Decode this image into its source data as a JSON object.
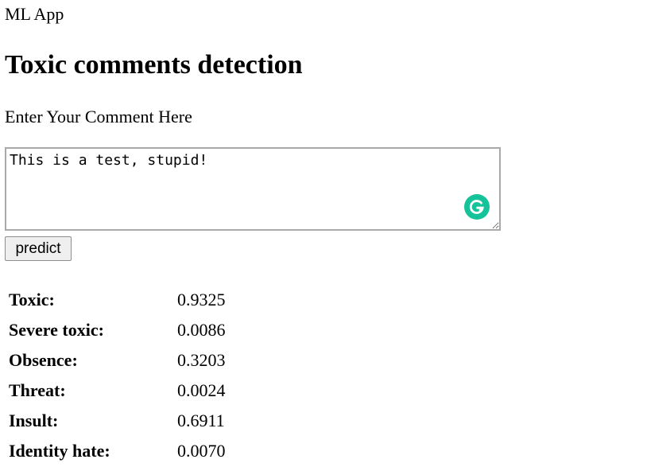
{
  "app_title": "ML App",
  "heading": "Toxic comments detection",
  "prompt_label": "Enter Your Comment Here",
  "comment": {
    "value": "This is a test, stupid!"
  },
  "grammar_badge": {
    "icon": "grammarly-icon",
    "color": "#15c39a"
  },
  "predict_label": "predict",
  "results": [
    {
      "label": "Toxic:",
      "value": "0.9325"
    },
    {
      "label": "Severe toxic:",
      "value": "0.0086"
    },
    {
      "label": "Obsence:",
      "value": "0.3203"
    },
    {
      "label": "Threat:",
      "value": "0.0024"
    },
    {
      "label": "Insult:",
      "value": "0.6911"
    },
    {
      "label": "Identity hate:",
      "value": "0.0070"
    }
  ]
}
